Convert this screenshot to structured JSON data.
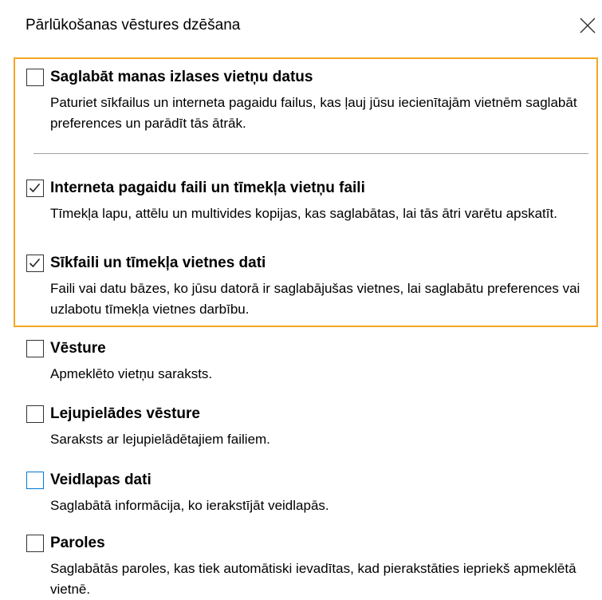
{
  "dialog": {
    "title": "Pārlūkošanas vēstures dzēšana",
    "close_icon": "close-x-icon"
  },
  "colors": {
    "highlight_border": "#f5a623",
    "checkbox_focus": "#0078d7",
    "divider": "#a0a0a0"
  },
  "options": [
    {
      "label": "Saglabāt manas izlases vietņu datus",
      "desc": "Paturiet sīkfailus un interneta pagaidu failus, kas ļauj jūsu iecienītajām vietnēm saglabāt preferences un parādīt tās ātrāk.",
      "checked": false
    },
    {
      "label": "Interneta pagaidu faili un tīmekļa vietņu faili",
      "desc": "Tīmekļa lapu, attēlu un multivides kopijas, kas saglabātas, lai tās ātri varētu apskatīt.",
      "checked": true
    },
    {
      "label": "Sīkfaili un tīmekļa vietnes dati",
      "desc": "Faili vai datu bāzes, ko jūsu datorā ir saglabājušas vietnes, lai saglabātu preferences vai uzlabotu tīmekļa vietnes darbību.",
      "checked": true
    },
    {
      "label": "Vēsture",
      "desc": "Apmeklēto vietņu saraksts.",
      "checked": false
    },
    {
      "label": "Lejupielādes vēsture",
      "desc": "Saraksts ar lejupielādētajiem failiem.",
      "checked": false
    },
    {
      "label": "Veidlapas dati",
      "desc": "Saglabātā informācija, ko ierakstījāt veidlapās.",
      "checked": false
    },
    {
      "label": "Paroles",
      "desc": "Saglabātās paroles, kas tiek automātiski ievadītas, kad pierakstāties iepriekš apmeklētā vietnē.",
      "checked": false
    }
  ]
}
